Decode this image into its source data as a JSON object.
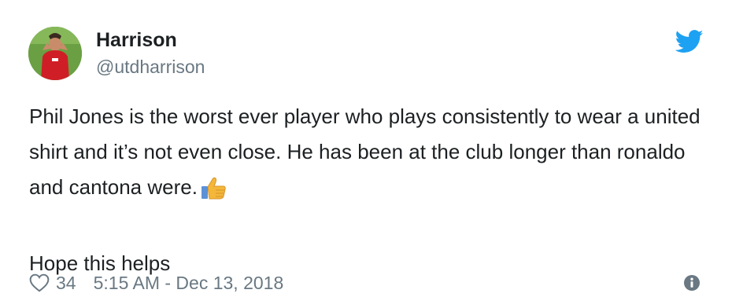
{
  "author": {
    "name": "Harrison",
    "handle": "@utdharrison"
  },
  "tweet": {
    "line1": "Phil Jones is the worst ever player who plays consistently to wear a united shirt and it’s not even close. He has been at the club longer than ronaldo and cantona were.",
    "line1_emoji": "thumbs-up",
    "line2": "Hope this helps"
  },
  "footer": {
    "likes": "34",
    "timestamp": "5:15 AM - Dec 13, 2018"
  },
  "icons": {
    "brand": "twitter-bird-icon",
    "like": "heart-icon",
    "info": "info-icon"
  },
  "colors": {
    "brand": "#1da1f2",
    "text": "#1c2022",
    "muted": "#697882"
  }
}
